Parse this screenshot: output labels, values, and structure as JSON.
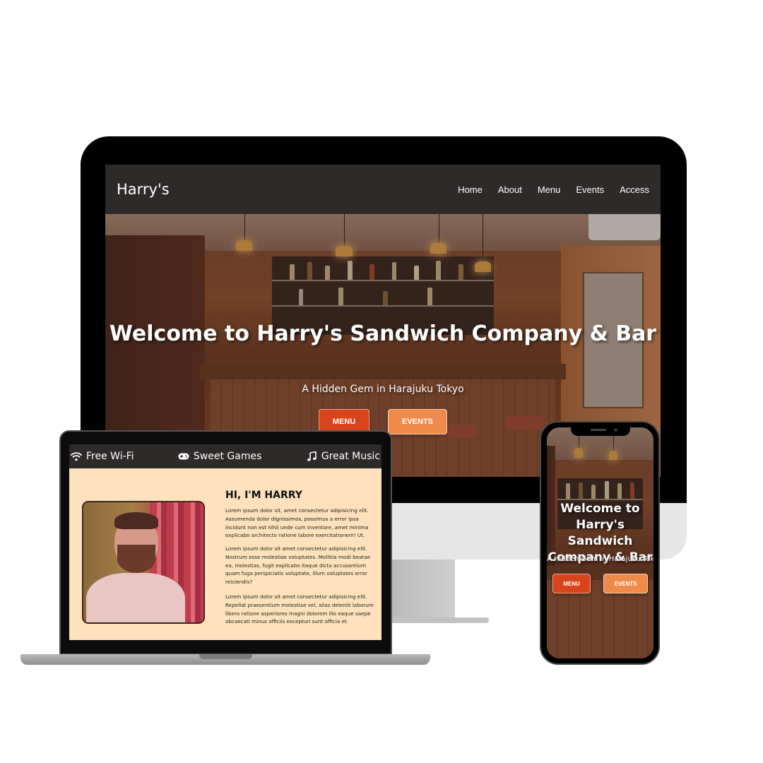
{
  "site": {
    "logo": "Harry's",
    "nav": [
      "Home",
      "About",
      "Menu",
      "Events",
      "Access"
    ],
    "hero": {
      "title": "Welcome to Harry's Sandwich Company & Bar",
      "subtitle": "A Hidden Gem in Harajuku Tokyo",
      "menu_button": "MENU",
      "events_button": "EVENTS"
    },
    "features": [
      {
        "label": "Free Wi-Fi",
        "icon": "wifi-icon"
      },
      {
        "label": "Sweet Games",
        "icon": "gamepad-icon"
      },
      {
        "label": "Great Music",
        "icon": "music-note-icon"
      }
    ],
    "about": {
      "title": "HI, I'M HARRY",
      "paragraphs": [
        "Lorem ipsum dolor sit, amet consectetur adipisicing elit. Assumenda dolor dignissimos, possimus a error ipsa incidunt non est nihil unde cum inventore, amet minima explicabo architecto ratione labore exercitationem! Ut.",
        "Lorem ipsum dolor sit amet consectetur adipisicing elit. Nostrum esse molestiae voluptates. Mollitia modi beatae ea, molestias, fugit explicabo itaque dicta accusantium quam fuga perspiciatis voluptate, illum voluptates error reiciendis?",
        "Lorem ipsum dolor sit amet consectetur adipisicing elit. Repellat praesentium molestiae vel, alias deleniti laborum libero ratione asperiores magni dolorem illo eaque saepe obcaecati minus officiis excepturi sunt officia et."
      ]
    }
  },
  "colors": {
    "nav_bg": "#2e2a29",
    "menu_button": "#d9441c",
    "events_button": "#f08a4b",
    "about_bg": "#ffe2bd"
  }
}
